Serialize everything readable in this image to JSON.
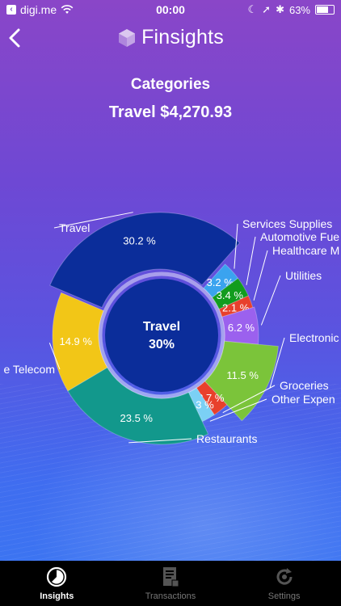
{
  "status_bar": {
    "carrier": "digi.me",
    "time": "00:00",
    "battery": "63%"
  },
  "app": {
    "name": "Finsights"
  },
  "page": {
    "title": "Categories",
    "selected": "Travel $4,270.93"
  },
  "center": {
    "label": "Travel",
    "percent": "30%"
  },
  "colors": {
    "travel": "#0b2d9a",
    "services": "#3aa3ef",
    "automotive": "#129c1e",
    "healthcare": "#e8402c",
    "utilities": "#9b61ee",
    "electronics": "#7bc43a",
    "groceries": "#e8402c",
    "other": "#7bd0f5",
    "restaurants": "#12988c",
    "telecom": "#f2c617"
  },
  "chart_data": {
    "type": "pie",
    "title": "Categories",
    "slices": [
      {
        "key": "travel",
        "label": "Travel",
        "value": 30.2,
        "value_label": "30.2 %"
      },
      {
        "key": "services",
        "label": "Services Supplies",
        "value": 3.2,
        "value_label": "3.2 %"
      },
      {
        "key": "automotive",
        "label": "Automotive Fue",
        "value": 3.4,
        "value_label": "3.4 %"
      },
      {
        "key": "healthcare",
        "label": "Healthcare M",
        "value": 2.1,
        "value_label": "2.1 %"
      },
      {
        "key": "utilities",
        "label": "Utilities",
        "value": 6.2,
        "value_label": "6.2 %"
      },
      {
        "key": "electronics",
        "label": "Electronic",
        "value": 11.5,
        "value_label": "11.5 %"
      },
      {
        "key": "groceries",
        "label": "Groceries",
        "value": 2.7,
        "value_label": "2.7 %"
      },
      {
        "key": "other",
        "label": "Other Expen",
        "value": 2.3,
        "value_label": "2.3 %"
      },
      {
        "key": "restaurants",
        "label": "Restaurants",
        "value": 23.5,
        "value_label": "23.5 %"
      },
      {
        "key": "telecom",
        "label": "e Telecom",
        "value": 14.9,
        "value_label": "14.9 %"
      }
    ]
  },
  "tabs": [
    {
      "label": "Insights",
      "icon": "pie-chart-icon",
      "active": true
    },
    {
      "label": "Transactions",
      "icon": "receipt-icon",
      "active": false
    },
    {
      "label": "Settings",
      "icon": "refresh-icon",
      "active": false
    }
  ]
}
